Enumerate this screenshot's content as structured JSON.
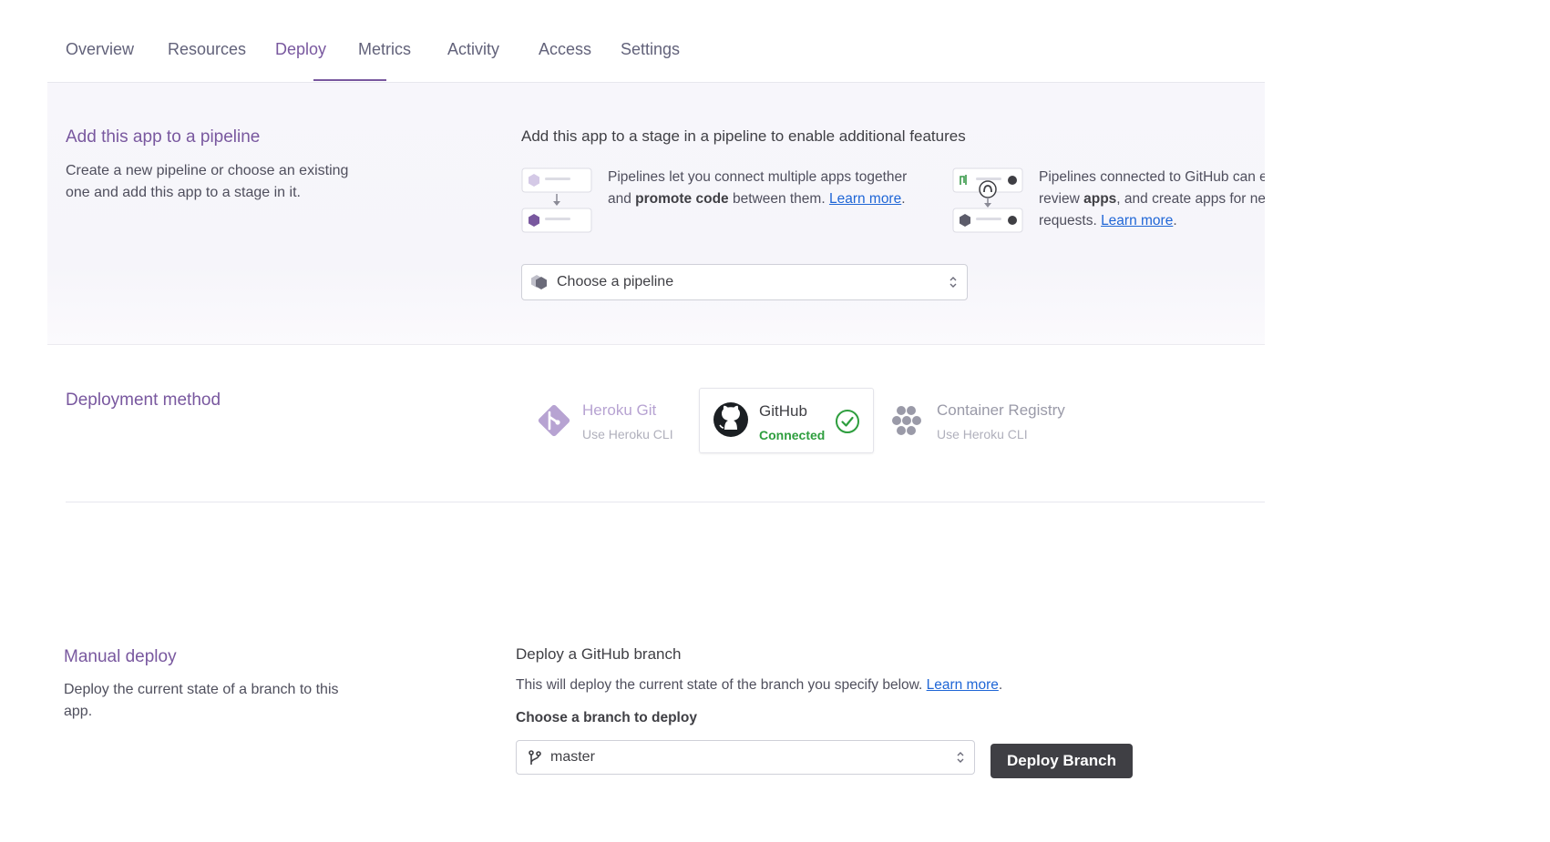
{
  "tabs": [
    {
      "label": "Overview",
      "active": false
    },
    {
      "label": "Resources",
      "active": false
    },
    {
      "label": "Deploy",
      "active": true
    },
    {
      "label": "Metrics",
      "active": false
    },
    {
      "label": "Activity",
      "active": false
    },
    {
      "label": "Access",
      "active": false
    },
    {
      "label": "Settings",
      "active": false
    }
  ],
  "pipeline": {
    "title": "Add this app to a pipeline",
    "description": "Create a new pipeline or choose an existing one and add this app to a stage in it.",
    "heading": "Add this app to a stage in a pipeline to enable additional features",
    "feature1": {
      "text_a": "Pipelines let you connect multiple apps together and ",
      "bold": "promote code",
      "text_b": " between them. ",
      "link": "Learn more",
      "end": "."
    },
    "feature2": {
      "text_a": "Pipelines connected to GitHub can enable review ",
      "bold": "apps",
      "text_b": ", and create apps for new pull requests. ",
      "link": "Learn more",
      "end": "."
    },
    "select_placeholder": "Choose a pipeline"
  },
  "deployment_method": {
    "title": "Deployment method",
    "methods": [
      {
        "name": "Heroku Git",
        "sub": "Use Heroku CLI",
        "active": false
      },
      {
        "name": "GitHub",
        "sub": "Connected",
        "active": true
      },
      {
        "name": "Container Registry",
        "sub": "Use Heroku CLI",
        "active": false
      }
    ]
  },
  "manual_deploy": {
    "title": "Manual deploy",
    "description": "Deploy the current state of a branch to this app.",
    "heading": "Deploy a GitHub branch",
    "info_text": "This will deploy the current state of the branch you specify below. ",
    "info_link": "Learn more",
    "info_end": ".",
    "branch_label": "Choose a branch to deploy",
    "branch_value": "master",
    "deploy_button": "Deploy Branch"
  },
  "colors": {
    "accent": "#79589f",
    "link": "#1f66d6",
    "connected": "#2e9e3e",
    "button_dark": "#3f3f44"
  }
}
